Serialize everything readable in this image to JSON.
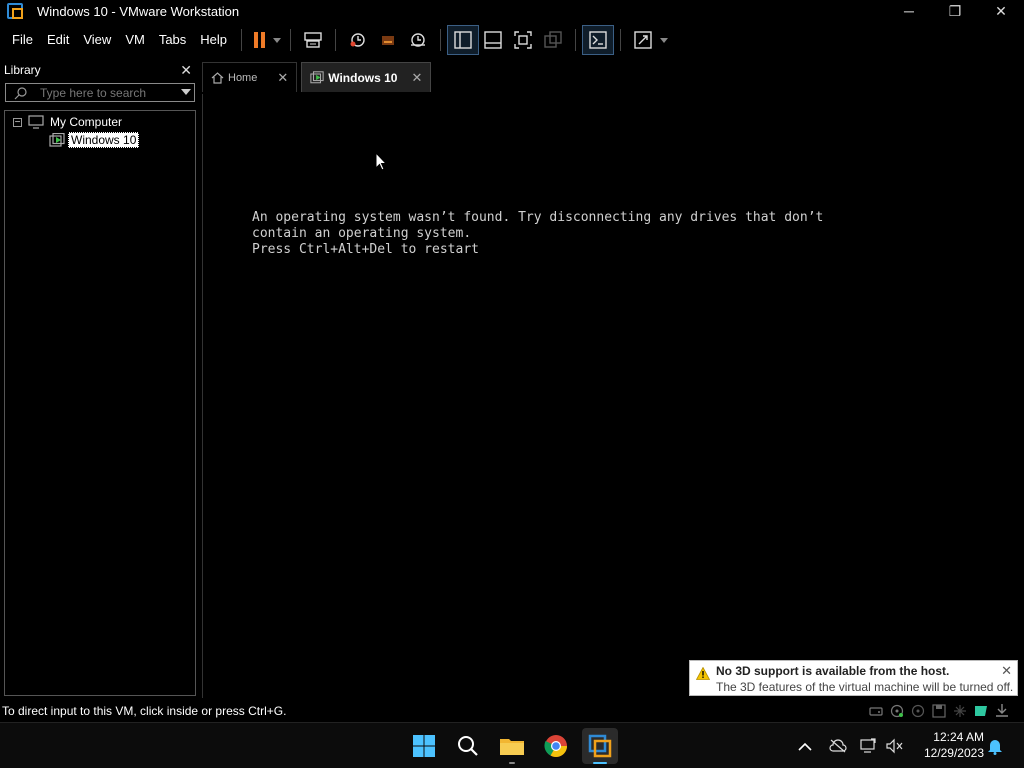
{
  "window": {
    "title": "Windows 10 - VMware Workstation",
    "controls": {
      "minimize": "─",
      "restore": "❐",
      "close": "✕"
    }
  },
  "menu": {
    "items": [
      "File",
      "Edit",
      "View",
      "VM",
      "Tabs",
      "Help"
    ]
  },
  "library": {
    "title": "Library",
    "close": "✕",
    "search_placeholder": "Type here to search",
    "tree": {
      "root": {
        "label": "My Computer",
        "expander": "−"
      },
      "child": {
        "label": "Windows 10",
        "selected": true
      }
    }
  },
  "tabs": [
    {
      "label": "Home",
      "close": "✕",
      "active": false
    },
    {
      "label": "Windows 10",
      "close": "✕",
      "active": true
    }
  ],
  "console": {
    "lines": [
      "An operating system wasn’t found. Try disconnecting any drives that don’t",
      "contain an operating system.",
      "Press Ctrl+Alt+Del to restart"
    ]
  },
  "notification": {
    "title": "No 3D support is available from the host.",
    "body": "The 3D features of the virtual machine will be turned off.",
    "close": "✕"
  },
  "statusbar": {
    "text": "To direct input to this VM, click inside or press Ctrl+G."
  },
  "taskbar": {
    "time": "12:24 AM",
    "date": "12/29/2023"
  },
  "colors": {
    "accent": "#4cc2ff",
    "pause": "#f07b27",
    "vmware_blue": "#2f8bd6",
    "vmware_orange": "#f0a11b",
    "warning": "#f5c400"
  }
}
